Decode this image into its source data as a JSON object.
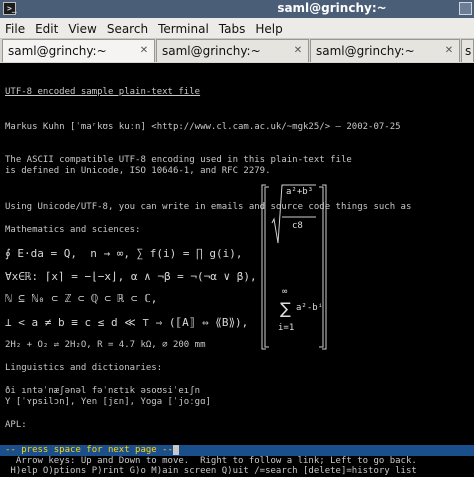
{
  "window": {
    "title": "saml@grinchy:~"
  },
  "menu": [
    "File",
    "Edit",
    "View",
    "Search",
    "Terminal",
    "Tabs",
    "Help"
  ],
  "tabs": [
    {
      "label": "saml@grinchy:~"
    },
    {
      "label": "saml@grinchy:~"
    },
    {
      "label": "saml@grinchy:~"
    },
    {
      "label": "s"
    }
  ],
  "terminal": {
    "heading": "UTF-8 encoded sample plain-text file",
    "author_line": "Markus Kuhn [ˈmaʳkʊs kuːn] <http://www.cl.cam.ac.uk/~mgk25/> — 2002-07-25",
    "para1_line1": "The ASCII compatible UTF-8 encoding used in this plain-text file",
    "para1_line2": "is defined in Unicode, ISO 10646-1, and RFC 2279.",
    "para2": "Using Unicode/UTF-8, you can write in emails and source code things such as",
    "math_heading": "Mathematics and sciences:",
    "math_lines": [
      "∮ E⋅da = Q,  n → ∞, ∑ f(i) = ∏ g(i),",
      "∀x∈ℝ: ⌈x⌉ = −⌊−x⌋, α ∧ ¬β = ¬(¬α ∨ β),",
      "ℕ ⊆ ℕ₀ ⊂ ℤ ⊂ ℚ ⊂ ℝ ⊂ ℂ,",
      "⊥ < a ≠ b ≡ c ≤ d ≪ ⊤ ⇒ (⟦A⟧ ⇔ ⟪B⟫),",
      "2H₂ + O₂ ⇌ 2H₂O, R = 4.7 kΩ, ⌀ 200 mm"
    ],
    "formula": {
      "numerator": "a²+b³",
      "denominator": "c8",
      "sum_top": "∞",
      "sum_symbol": "∑",
      "sum_term": "a²-bⁱ",
      "sum_bottom": "i=1"
    },
    "ling_heading": "Linguistics and dictionaries:",
    "ling_line1": "ði ıntəˈnæʃənəl fəˈnɛtık əsoʊsiˈeıʃn",
    "ling_line2": "Y [ˈʏpsilɔn], Yen [jɛn], Yoga [ˈjoːgɑ]",
    "apl_heading": "APL:"
  },
  "status": {
    "prompt": "-- press space for next page --",
    "hint1": "  Arrow keys: Up and Down to move.  Right to follow a link; Left to go back.",
    "hint2": " H)elp O)ptions P)rint G)o M)ain screen Q)uit /=search [delete]=history list"
  }
}
